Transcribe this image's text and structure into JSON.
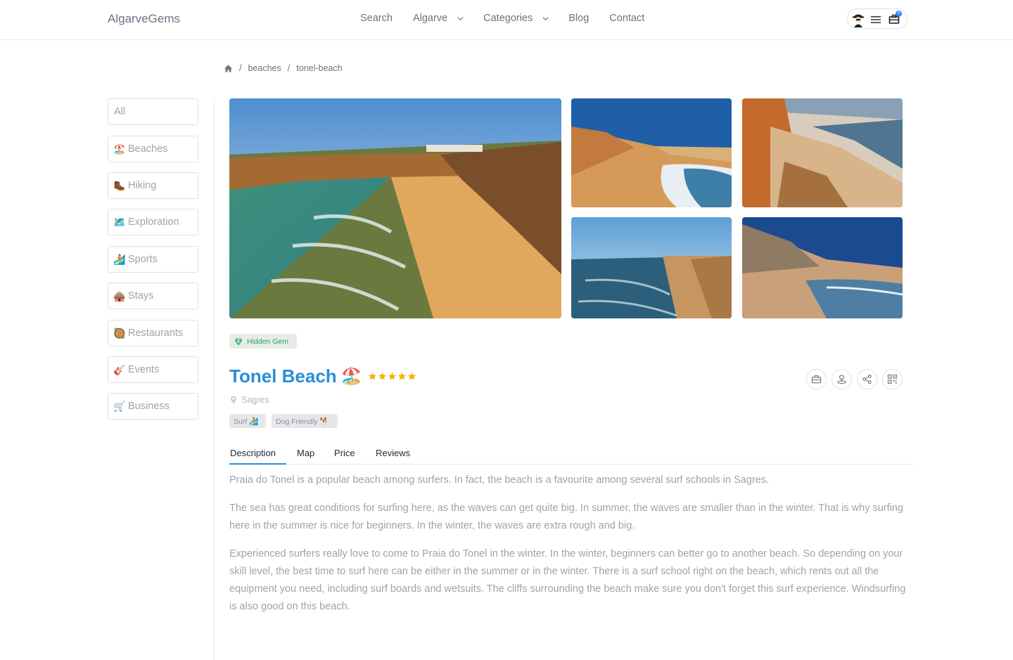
{
  "header": {
    "logo": "AlgarveGems",
    "nav": {
      "search": "Search",
      "algarve": "Algarve",
      "categories": "Categories",
      "blog": "Blog",
      "contact": "Contact"
    },
    "cart_count": "0"
  },
  "breadcrumb": {
    "items": [
      "beaches",
      "tonel-beach"
    ],
    "separator": "/"
  },
  "sidebar": {
    "items": [
      {
        "icon": "",
        "label": "All"
      },
      {
        "icon": "🏖️",
        "label": "Beaches"
      },
      {
        "icon": "🥾",
        "label": "Hiking"
      },
      {
        "icon": "🗺️",
        "label": "Exploration"
      },
      {
        "icon": "🏄",
        "label": "Sports"
      },
      {
        "icon": "🛖",
        "label": "Stays"
      },
      {
        "icon": "🥘",
        "label": "Restaurants"
      },
      {
        "icon": "🎸",
        "label": "Events"
      },
      {
        "icon": "🛒",
        "label": "Business"
      }
    ]
  },
  "place": {
    "badge": "Hidden Gem",
    "title": "Tonel Beach",
    "title_emoji": "🏖️",
    "rating": 5,
    "location": "Sagres",
    "tags": [
      "Surf 🏄",
      "Dog Friendly 🐕"
    ]
  },
  "tabs": {
    "description": "Description",
    "map": "Map",
    "price": "Price",
    "reviews": "Reviews",
    "active": "Description"
  },
  "description": {
    "paragraphs": [
      "Praia do Tonel is a popular beach among surfers. In fact, the beach is a favourite among several surf schools in Sagres.",
      "The sea has great conditions for surfing here, as the waves can get quite big. In summer, the waves are smaller than in the winter. That is why surfing here in the summer is nice for beginners. In the winter, the waves are extra rough and big.",
      "Experienced surfers really love to come to Praia do Tonel in the winter. In the winter, beginners can better go to another beach. So depending on your skill level, the best time to surf here can be either in the summer or in the winter. There is a surf school right on the beach, which rents out all the equipment you need, including surf boards and wetsuits. The cliffs surrounding the beach make sure you don't forget this surf experience. Windsurfing is also good on this beach."
    ]
  },
  "colors": {
    "title": "#2b8ed6",
    "gem": "#22a35b",
    "star": "#f5b301"
  }
}
